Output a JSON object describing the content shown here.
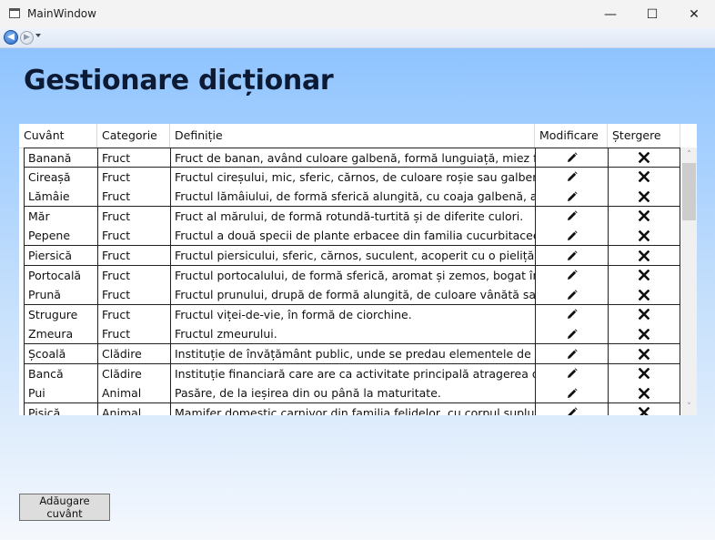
{
  "window": {
    "title": "MainWindow",
    "minimize_glyph": "—",
    "maximize_glyph": "☐",
    "close_glyph": "✕"
  },
  "nav": {
    "back_glyph": "◀",
    "forward_glyph": "▶",
    "back_icon": "back-arrow-icon",
    "forward_icon": "forward-arrow-icon"
  },
  "page": {
    "title": "Gestionare dicționar"
  },
  "table": {
    "columns": [
      "Cuvânt",
      "Categorie",
      "Definiție",
      "Modificare",
      "Ștergere"
    ],
    "edit_icon": "pencil-icon",
    "delete_icon": "x-icon",
    "rows": [
      {
        "word": "Banană",
        "category": "Fruct",
        "definition": "Fruct de banan, având culoare galbenă, formă lunguiață, miez făinos"
      },
      {
        "word": "Cireașă",
        "category": "Fruct",
        "definition": "Fructul cireșului, mic, sferic, cărnos, de culoare roșie sau galbenă"
      },
      {
        "word": "Lămâie",
        "category": "Fruct",
        "definition": "Fructul lămâiului, de formă sferică alungită, cu coaja galbenă, aromată"
      },
      {
        "word": "Măr",
        "category": "Fruct",
        "definition": "Fruct al mărului, de formă rotundă-turtită și de diferite culori."
      },
      {
        "word": "Pepene",
        "category": "Fruct",
        "definition": "Fructul a două specii de plante erbacee din familia cucurbitaceelor"
      },
      {
        "word": "Piersică",
        "category": "Fruct",
        "definition": "Fructul piersicului, sferic, cărnos, suculent, acoperit cu o pieliță pufoasă"
      },
      {
        "word": "Portocală",
        "category": "Fruct",
        "definition": "Fructul portocalului, de formă sferică, aromat și zemos, bogat în vitamina C"
      },
      {
        "word": "Prună",
        "category": "Fruct",
        "definition": "Fructul prunului, drupă de formă alungită, de culoare vânătă sau galbenă"
      },
      {
        "word": "Strugure",
        "category": "Fruct",
        "definition": "Fructul viței-de-vie, în formă de ciorchine."
      },
      {
        "word": "Zmeura",
        "category": "Fruct",
        "definition": "Fructul zmeurului."
      },
      {
        "word": "Școală",
        "category": "Clădire",
        "definition": "Instituție de învățământ public, unde se predau elementele de bază"
      },
      {
        "word": "Bancă",
        "category": "Clădire",
        "definition": "Instituție financiară care are ca activitate principală atragerea de fonduri"
      },
      {
        "word": "Pui",
        "category": "Animal",
        "definition": "Pasăre, de la ieșirea din ou până la maturitate."
      },
      {
        "word": "Pisică",
        "category": "Animal",
        "definition": "Mamifer domestic carnivor din familia felidelor, cu corpul suplu"
      }
    ]
  },
  "scrollbar": {
    "up_glyph": "˄",
    "down_glyph": "˅"
  },
  "actions": {
    "add_label": "Adăugare cuvânt"
  },
  "colors": {
    "background_top": "#8fc4ff",
    "background_bottom": "#f5f8fd",
    "title_text": "#0d1a33",
    "grid_line": "#222222"
  }
}
